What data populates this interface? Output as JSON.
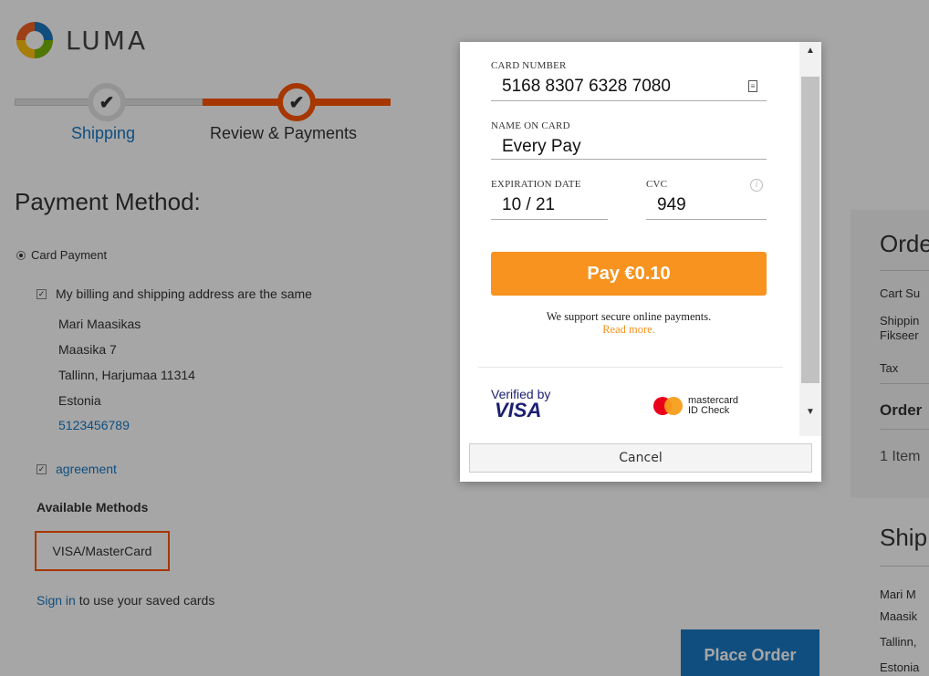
{
  "brand": {
    "name": "LUMA",
    "colors": {
      "blue": "#1979c3",
      "orange": "#ff5501",
      "pay": "#f7931e"
    }
  },
  "progress": {
    "steps": [
      {
        "label": "Shipping",
        "icon": "check-icon"
      },
      {
        "label": "Review & Payments",
        "icon": "check-icon"
      }
    ]
  },
  "payment": {
    "title": "Payment Method:",
    "method_radio": "Card Payment",
    "billing_same": "My billing and shipping address are the same",
    "address": [
      "Mari Maasikas",
      "Maasika 7",
      "Tallinn, Harjumaa 11314",
      "Estonia"
    ],
    "phone": "5123456789",
    "agreement": "agreement",
    "available_methods": "Available Methods",
    "method_button": "VISA/MasterCard",
    "signin_link": "Sign in",
    "signin_rest": " to use your saved cards",
    "place_order": "Place Order"
  },
  "summary": {
    "title": "Orde",
    "lines": [
      "Cart Su",
      "Shippin",
      "Fikseer",
      "Tax"
    ],
    "order_total": "Order",
    "items": "1 Item",
    "ship_title": "Ship",
    "ship_lines": [
      "Mari M",
      "Maasik",
      "Tallinn,",
      "Estonia"
    ]
  },
  "modal": {
    "card_number_label": "CARD NUMBER",
    "card_number": "5168 8307 6328 7080",
    "name_label": "NAME ON CARD",
    "name": "Every Pay",
    "exp_label": "EXPIRATION DATE",
    "exp": "10 / 21",
    "cvc_label": "CVC",
    "cvc": "949",
    "pay_button": "Pay €0.10",
    "secure_text": "We support secure online payments.",
    "read_more": "Read more.",
    "verified_by": "Verified by",
    "visa": "VISA",
    "mc_line1": "mastercard",
    "mc_line2": "ID Check",
    "cancel": "Cancel"
  }
}
